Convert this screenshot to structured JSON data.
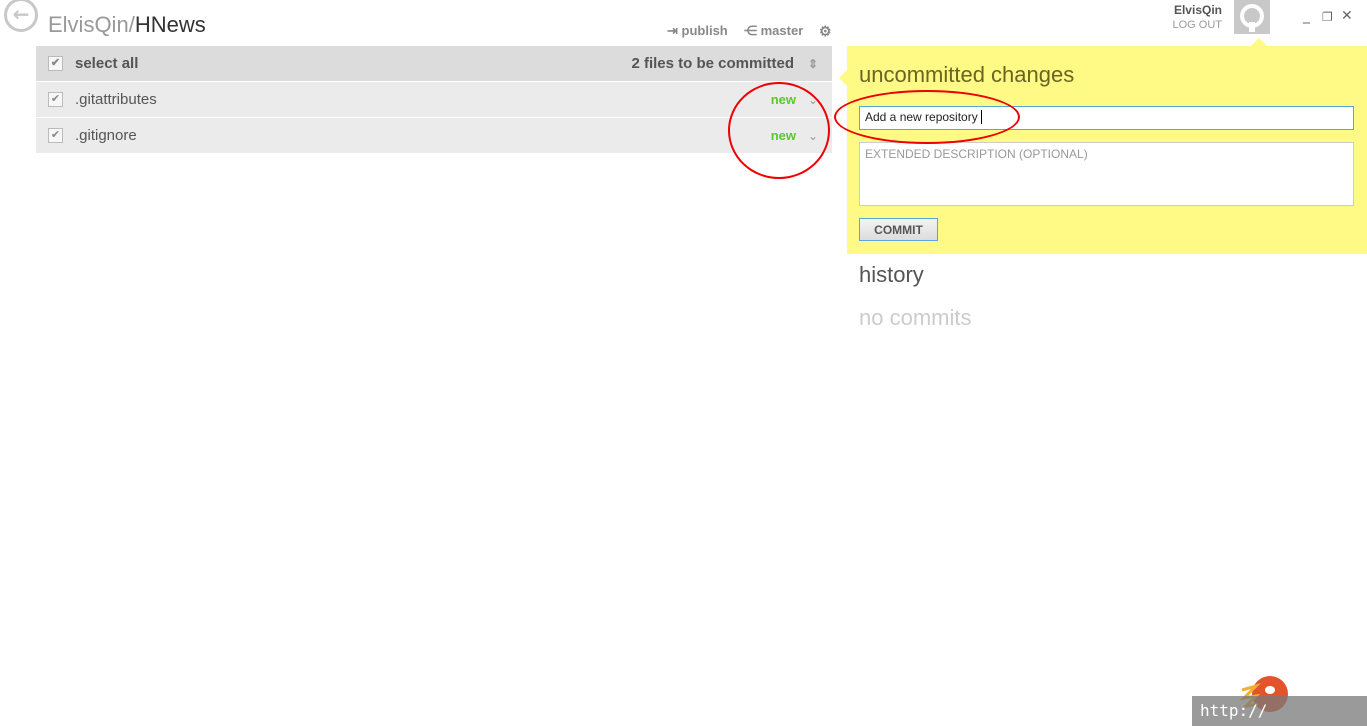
{
  "header": {
    "owner": "ElvisQin",
    "separator": "/",
    "repo": "HNews",
    "publish_label": "publish",
    "branch_label": "master"
  },
  "user": {
    "name": "ElvisQin",
    "logout_label": "LOG OUT"
  },
  "changes": {
    "select_all_label": "select all",
    "count_label": "2 files to be committed",
    "files": [
      {
        "name": ".gitattributes",
        "status": "new",
        "checked": true
      },
      {
        "name": ".gitignore",
        "status": "new",
        "checked": true
      }
    ],
    "status_color": "#5ac82e"
  },
  "panel": {
    "title": "uncommitted changes",
    "summary_value": "Add a new repository",
    "description_placeholder": "EXTENDED DESCRIPTION (OPTIONAL)",
    "commit_label": "COMMIT",
    "background": "#fff985"
  },
  "history": {
    "title": "history",
    "empty_label": "no commits"
  },
  "watermark": {
    "text": "http://"
  }
}
